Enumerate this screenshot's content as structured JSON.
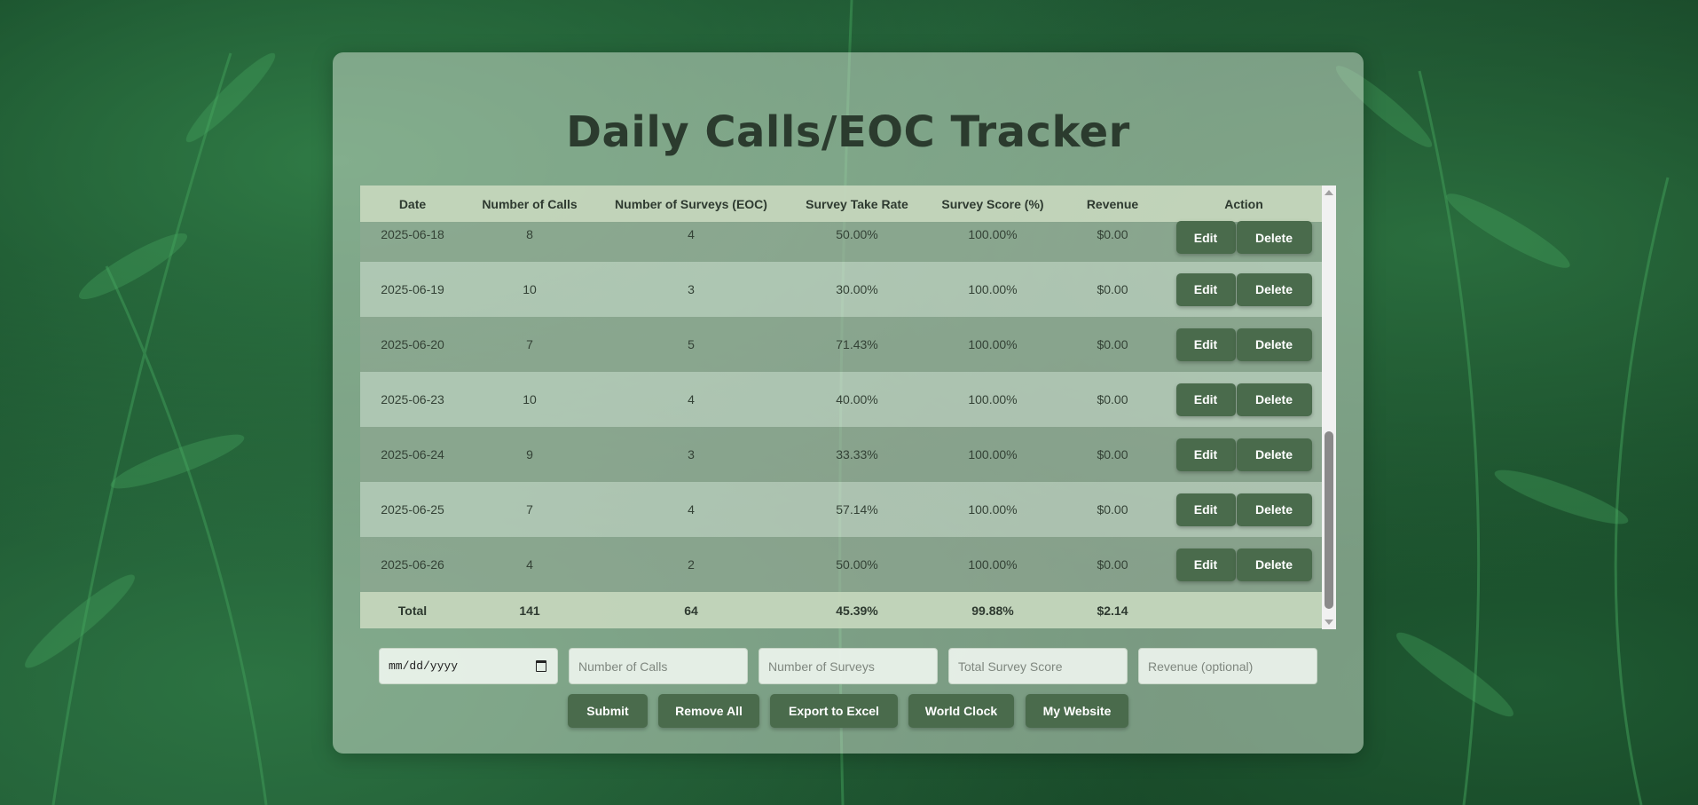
{
  "app": {
    "title": "Daily Calls/EOC Tracker"
  },
  "table": {
    "headers": [
      "Date",
      "Number of Calls",
      "Number of Surveys (EOC)",
      "Survey Take Rate",
      "Survey Score (%)",
      "Revenue",
      "Action"
    ],
    "rows": [
      {
        "date": "2025-06-18",
        "calls": "8",
        "surveys": "4",
        "take_rate": "50.00%",
        "score": "100.00%",
        "revenue": "$0.00"
      },
      {
        "date": "2025-06-19",
        "calls": "10",
        "surveys": "3",
        "take_rate": "30.00%",
        "score": "100.00%",
        "revenue": "$0.00"
      },
      {
        "date": "2025-06-20",
        "calls": "7",
        "surveys": "5",
        "take_rate": "71.43%",
        "score": "100.00%",
        "revenue": "$0.00"
      },
      {
        "date": "2025-06-23",
        "calls": "10",
        "surveys": "4",
        "take_rate": "40.00%",
        "score": "100.00%",
        "revenue": "$0.00"
      },
      {
        "date": "2025-06-24",
        "calls": "9",
        "surveys": "3",
        "take_rate": "33.33%",
        "score": "100.00%",
        "revenue": "$0.00"
      },
      {
        "date": "2025-06-25",
        "calls": "7",
        "surveys": "4",
        "take_rate": "57.14%",
        "score": "100.00%",
        "revenue": "$0.00"
      },
      {
        "date": "2025-06-26",
        "calls": "4",
        "surveys": "2",
        "take_rate": "50.00%",
        "score": "100.00%",
        "revenue": "$0.00"
      }
    ],
    "row_actions": {
      "edit_label": "Edit",
      "delete_label": "Delete"
    },
    "total": {
      "label": "Total",
      "calls": "141",
      "surveys": "64",
      "take_rate": "45.39%",
      "score": "99.88%",
      "revenue": "$2.14"
    }
  },
  "form": {
    "date_value": "mm/dd/yyyy",
    "calls_placeholder": "Number of Calls",
    "surveys_placeholder": "Number of Surveys",
    "score_placeholder": "Total Survey Score",
    "revenue_placeholder": "Revenue (optional)"
  },
  "buttons": {
    "submit": "Submit",
    "remove_all": "Remove All",
    "export": "Export to Excel",
    "world_clock": "World Clock",
    "my_website": "My Website"
  },
  "colors": {
    "button": "#4a6b4c",
    "title": "#2b3b2e",
    "background": "#1d5231"
  },
  "icons": {
    "date_picker": "calendar-icon"
  }
}
